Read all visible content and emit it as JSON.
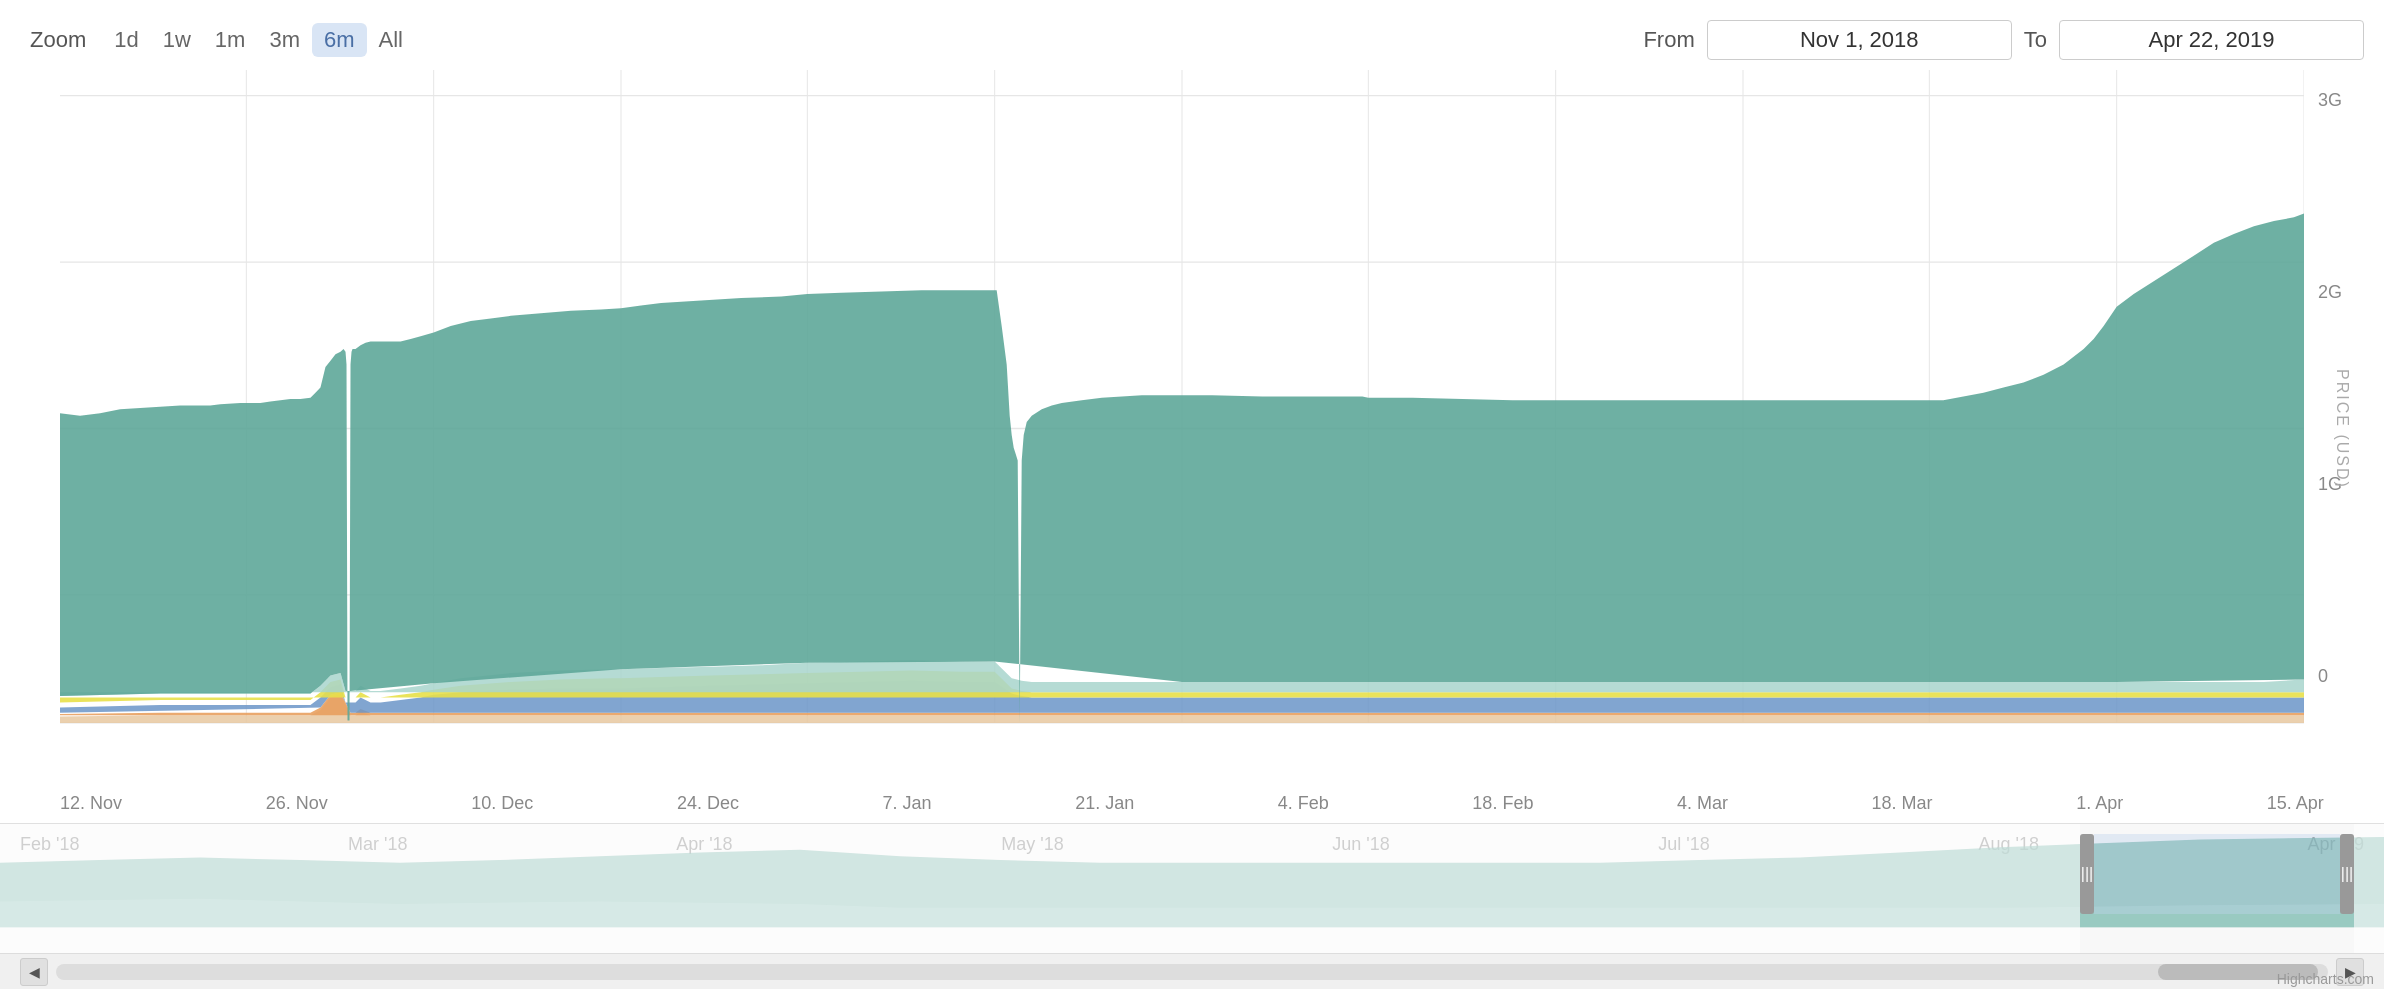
{
  "toolbar": {
    "zoom_label": "Zoom",
    "zoom_buttons": [
      {
        "label": "1d",
        "active": false
      },
      {
        "label": "1w",
        "active": false
      },
      {
        "label": "1m",
        "active": false
      },
      {
        "label": "3m",
        "active": false
      },
      {
        "label": "6m",
        "active": true
      },
      {
        "label": "All",
        "active": false
      }
    ],
    "from_label": "From",
    "from_value": "Nov 1, 2018",
    "to_label": "To",
    "to_value": "Apr 22, 2019"
  },
  "y_axis": {
    "ticks": [
      "3G",
      "2G",
      "1G",
      "0"
    ],
    "label": "PRICE (USD)"
  },
  "x_axis": {
    "ticks": [
      "12. Nov",
      "26. Nov",
      "10. Dec",
      "24. Dec",
      "7. Jan",
      "21. Jan",
      "4. Feb",
      "18. Feb",
      "4. Mar",
      "18. Mar",
      "1. Apr",
      "15. Apr"
    ]
  },
  "navigator": {
    "x_labels": [
      "Feb '18",
      "Mar '18",
      "Apr '18",
      "May '18",
      "Jun '18",
      "Jul '18",
      "Aug '18",
      "Apr '19"
    ]
  },
  "colors": {
    "green_top": "#5fa89a",
    "teal_mid": "#7bbcb0",
    "light_teal": "#a8d5cd",
    "yellow": "#e8e04a",
    "blue": "#6b96c8",
    "orange": "#e8a060",
    "light_orange": "#e8c8a0",
    "grid_line": "#e6e6e6",
    "background": "#ffffff"
  },
  "credits": "Highcharts.com"
}
